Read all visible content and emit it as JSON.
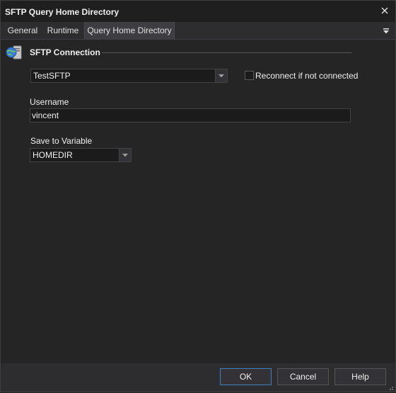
{
  "window": {
    "title": "SFTP Query Home Directory",
    "close_icon": "close-icon"
  },
  "tabs": [
    {
      "label": "General",
      "active": false
    },
    {
      "label": "Runtime",
      "active": false
    },
    {
      "label": "Query Home Directory",
      "active": true
    }
  ],
  "tab_menu_icon": "menu-arrow-icon",
  "section": {
    "title": "SFTP Connection",
    "icon": "sftp-connection-icon"
  },
  "connection": {
    "selected": "TestSFTP",
    "reconnect_label": "Reconnect if not connected",
    "reconnect_checked": false
  },
  "username": {
    "label": "Username",
    "value": "vincent"
  },
  "save_variable": {
    "label": "Save to Variable",
    "selected": "HOMEDIR"
  },
  "buttons": {
    "ok": "OK",
    "cancel": "Cancel",
    "help": "Help"
  },
  "colors": {
    "background": "#2d2d30",
    "panel": "#252526",
    "field": "#1b1b1c",
    "accent": "#3f7fbf"
  }
}
